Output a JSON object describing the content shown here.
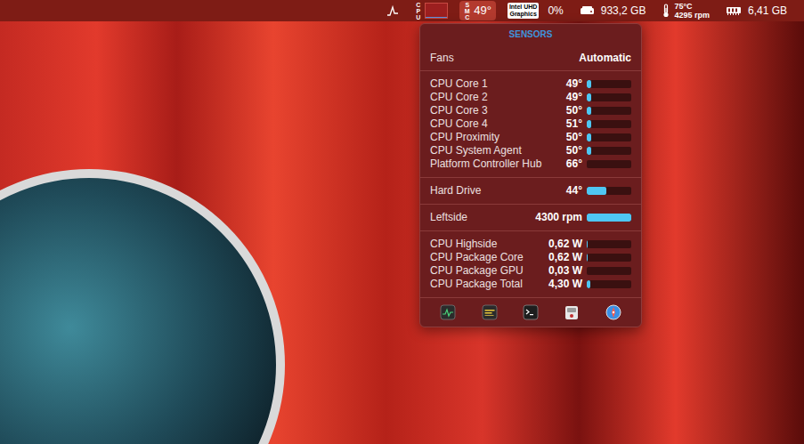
{
  "menubar": {
    "items": [
      {
        "kind": "activity",
        "selected": false
      },
      {
        "kind": "chart",
        "label": "CPU",
        "level": 0.08,
        "selected": false
      },
      {
        "kind": "sensor",
        "label": "SMC",
        "value": "49°",
        "selected": true
      },
      {
        "kind": "gpu",
        "badge": [
          "Intel UHD",
          "Graphics"
        ],
        "value": "0%",
        "selected": false
      },
      {
        "kind": "disk",
        "value": "933,2 GB",
        "selected": false
      },
      {
        "kind": "fan",
        "lines": [
          "75°C",
          "4295 rpm"
        ],
        "selected": false
      },
      {
        "kind": "ram",
        "value": "6,41 GB",
        "selected": false
      }
    ]
  },
  "popup": {
    "title": "SENSORS",
    "fans": {
      "label": "Fans",
      "value": "Automatic"
    },
    "sections": [
      {
        "rows": [
          {
            "label": "CPU Core 1",
            "value": "49°",
            "level": 0.1
          },
          {
            "label": "CPU Core 2",
            "value": "49°",
            "level": 0.1
          },
          {
            "label": "CPU Core 3",
            "value": "50°",
            "level": 0.1
          },
          {
            "label": "CPU Core 4",
            "value": "51°",
            "level": 0.1
          },
          {
            "label": "CPU Proximity",
            "value": "50°",
            "level": 0.1
          },
          {
            "label": "CPU System Agent",
            "value": "50°",
            "level": 0.1
          },
          {
            "label": "Platform Controller Hub",
            "value": "66°",
            "level": 0
          }
        ]
      },
      {
        "rows": [
          {
            "label": "Hard Drive",
            "value": "44°",
            "level": 0.44
          }
        ]
      },
      {
        "rows": [
          {
            "label": "Leftside",
            "value": "4300 rpm",
            "level": 1
          }
        ]
      },
      {
        "rows": [
          {
            "label": "CPU Highside",
            "value": "0,62 W",
            "level": 0.02
          },
          {
            "label": "CPU Package Core",
            "value": "0,62 W",
            "level": 0.02
          },
          {
            "label": "CPU Package GPU",
            "value": "0,03 W",
            "level": 0
          },
          {
            "label": "CPU Package Total",
            "value": "4,30 W",
            "level": 0.08
          }
        ]
      }
    ],
    "toolbar": [
      {
        "kind": "activity"
      },
      {
        "kind": "console"
      },
      {
        "kind": "terminal"
      },
      {
        "kind": "disk-utility"
      },
      {
        "kind": "safari"
      }
    ]
  }
}
